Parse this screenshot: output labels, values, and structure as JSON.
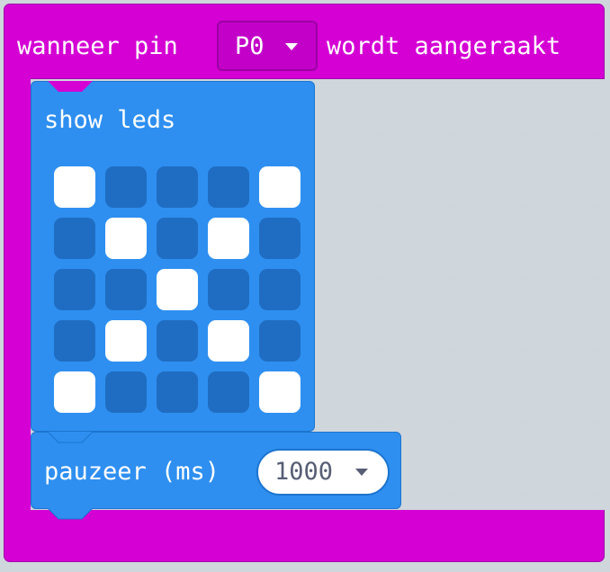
{
  "event_block": {
    "prefix": "wanneer pin",
    "pin_value": "P0",
    "suffix": "wordt aangeraakt",
    "color": "#d400d4"
  },
  "show_leds": {
    "title": "show leds",
    "color": "#2e8ff0",
    "grid": [
      [
        true,
        false,
        false,
        false,
        true
      ],
      [
        false,
        true,
        false,
        true,
        false
      ],
      [
        false,
        false,
        true,
        false,
        false
      ],
      [
        false,
        true,
        false,
        true,
        false
      ],
      [
        true,
        false,
        false,
        false,
        true
      ]
    ]
  },
  "pause": {
    "label": "pauzeer (ms)",
    "value": "1000"
  },
  "icons": {
    "pin_dropdown": "chevron-down-icon",
    "pause_dropdown": "chevron-down-icon"
  }
}
